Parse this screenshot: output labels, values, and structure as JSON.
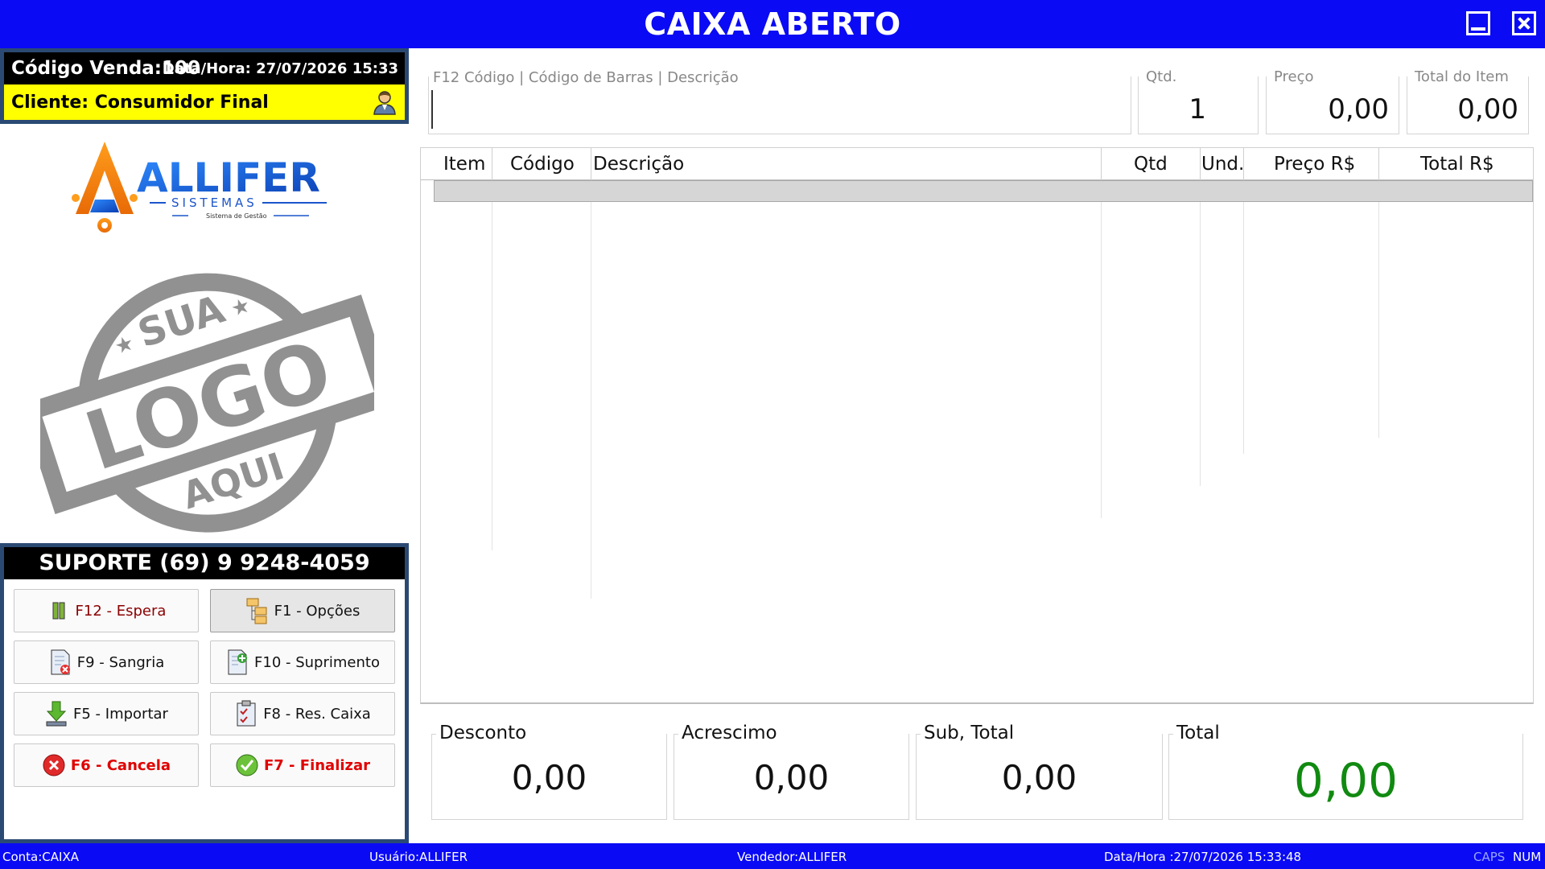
{
  "window": {
    "title": "CAIXA ABERTO"
  },
  "sale": {
    "code_label": "Código Venda:100",
    "datetime_label": "Data/Hora: 27/07/2026 15:33",
    "client_label": "Cliente: Consumidor Final"
  },
  "brand": {
    "name": "ALLIFER",
    "sub": "SISTEMAS",
    "tagline": "Sistema de Gestão"
  },
  "logo_placeholder": {
    "line1": "SUA",
    "line2": "LOGO",
    "line3": "AQUI"
  },
  "support": {
    "title": "SUPORTE (69) 9 9248-4059"
  },
  "buttons": {
    "espera": "F12 - Espera",
    "opcoes": "F1 - Opções",
    "sangria": "F9 - Sangria",
    "suprimento": "F10 - Suprimento",
    "importar": "F5 - Importar",
    "res_caixa": "F8 - Res. Caixa",
    "cancela": "F6 - Cancela",
    "finalizar": "F7 - Finalizar"
  },
  "entry": {
    "label": "F12  Código | Código de Barras | Descrição",
    "value": "",
    "qtd_label": "Qtd.",
    "qtd_value": "1",
    "preco_label": "Preço",
    "preco_value": "0,00",
    "total_item_label": "Total do Item",
    "total_item_value": "0,00"
  },
  "grid": {
    "columns": [
      "Item",
      "Código",
      "Descrição",
      "Qtd",
      "Und.",
      "Preço R$",
      "Total R$"
    ]
  },
  "totals": {
    "desconto_label": "Desconto",
    "desconto_value": "0,00",
    "acrescimo_label": "Acrescimo",
    "acrescimo_value": "0,00",
    "subtotal_label": "Sub, Total",
    "subtotal_value": "0,00",
    "total_label": "Total",
    "total_value": "0,00"
  },
  "status": {
    "conta": "Conta:CAIXA",
    "usuario": "Usuário:ALLIFER",
    "vendedor": "Vendedor:ALLIFER",
    "datahora": "Data/Hora :27/07/2026 15:33:48",
    "caps": "CAPS",
    "num": "NUM"
  },
  "colors": {
    "titlebar": "#0a0af5",
    "client_bg": "#ffff00",
    "total_value": "#108a10",
    "panel_border": "#2b4a73"
  }
}
